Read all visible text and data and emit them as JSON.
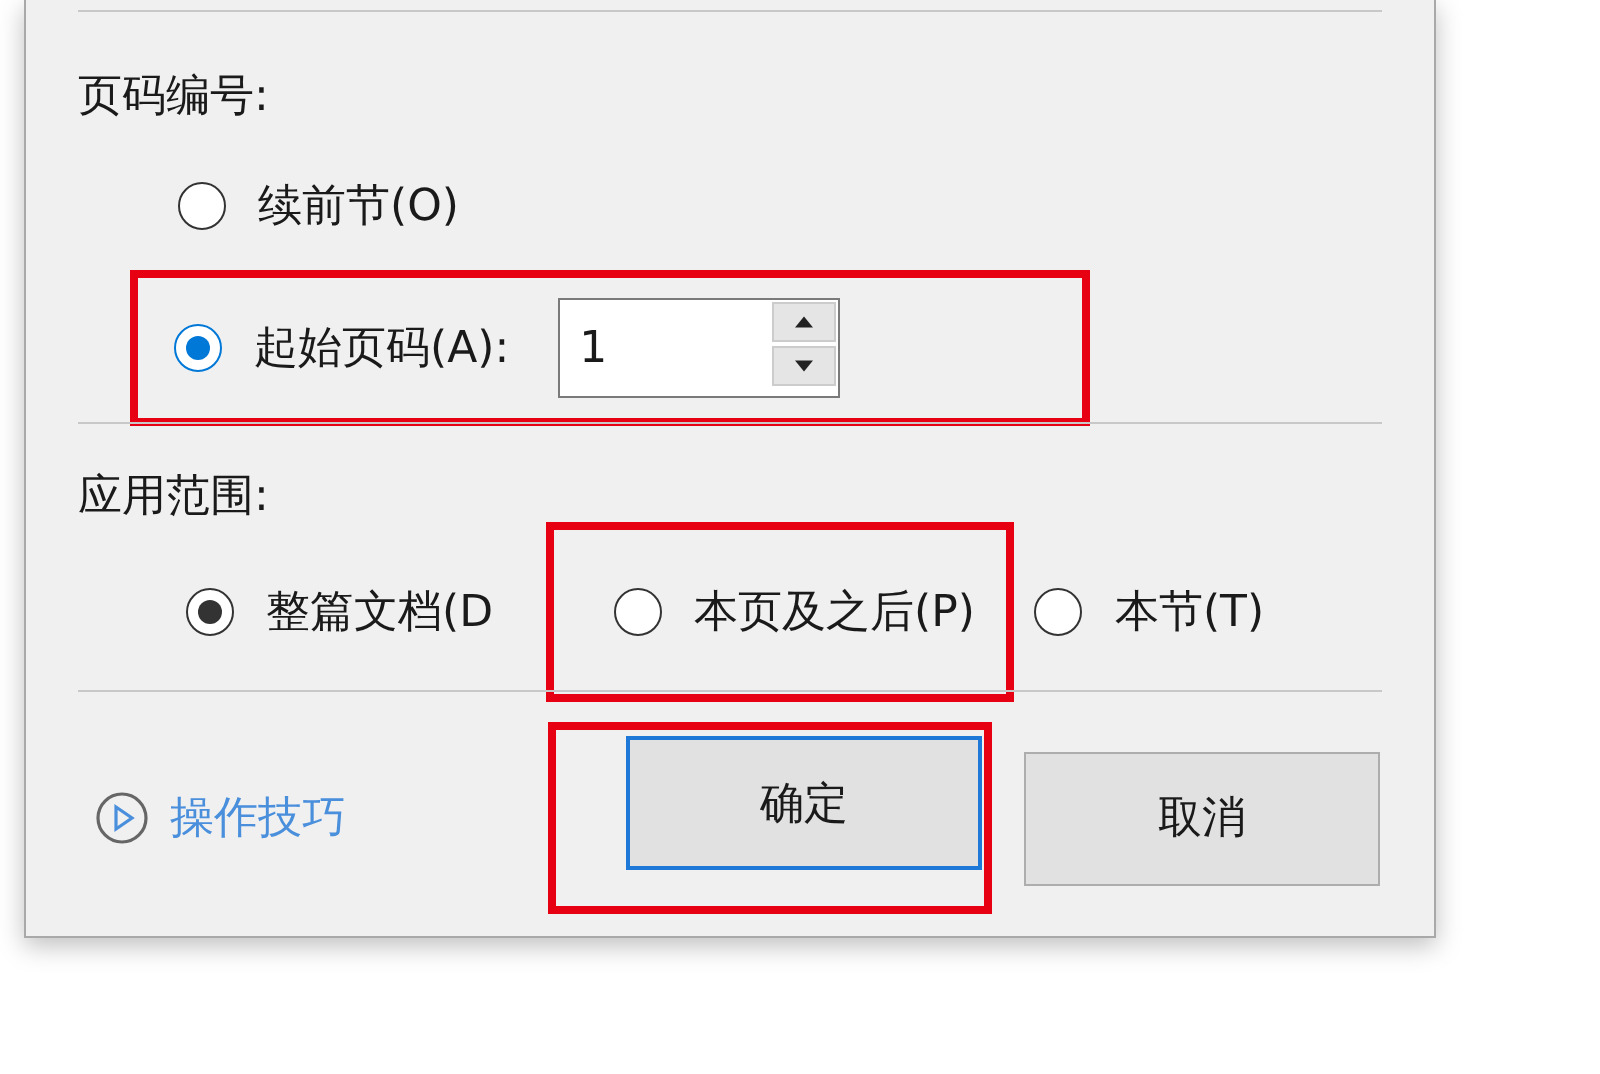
{
  "page_numbering": {
    "label": "页码编号:",
    "options": [
      {
        "kind": "plain",
        "label": "续前节(O)",
        "selected": false,
        "highlighted": false
      },
      {
        "kind": "spinner",
        "label": "起始页码(A):",
        "value": "1",
        "selected": true,
        "highlighted": true
      }
    ]
  },
  "scope": {
    "label": "应用范围:",
    "options": [
      {
        "label": "整篇文档(D",
        "selected": true,
        "highlighted": false
      },
      {
        "label": "本页及之后(P)",
        "selected": false,
        "highlighted": true
      },
      {
        "label": "本节(T)",
        "selected": false,
        "highlighted": false
      }
    ]
  },
  "footer": {
    "tips_link": "操作技巧",
    "buttons": [
      {
        "label": "确定",
        "default": true,
        "highlighted": true
      },
      {
        "label": "取消",
        "default": false,
        "highlighted": false
      }
    ]
  }
}
